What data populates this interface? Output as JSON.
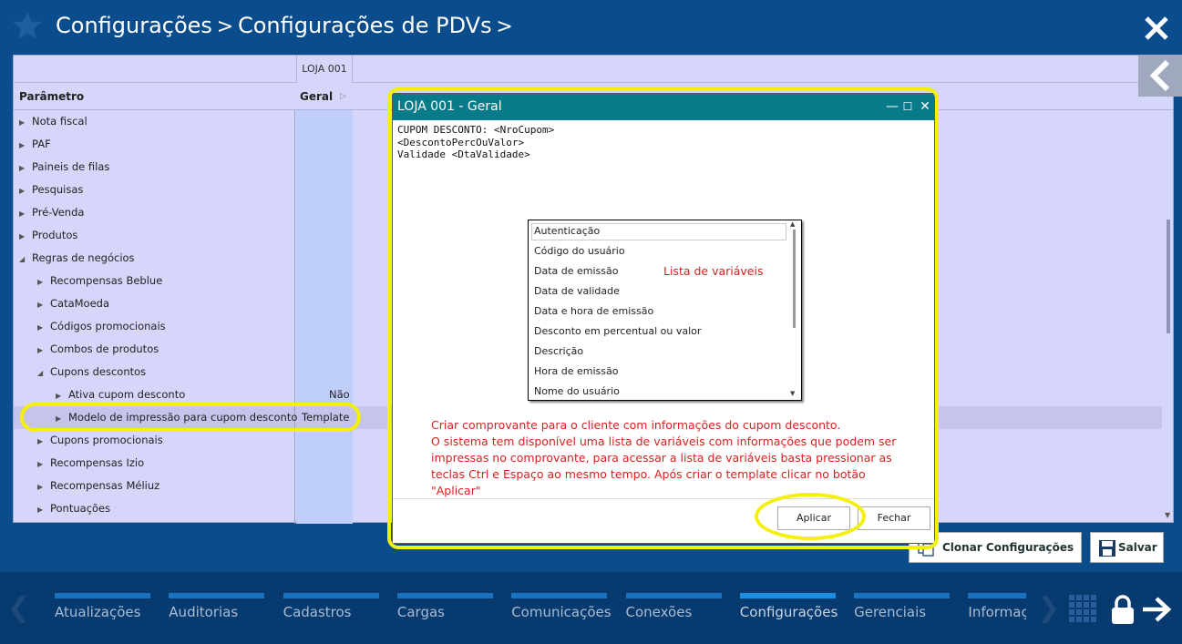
{
  "header": {
    "crumb_1": "Configurações",
    "crumb_2": "Configurações de PDVs",
    "separator": ">",
    "icons": [
      "star-icon",
      "close-icon"
    ]
  },
  "grid": {
    "loja_column": "LOJA 001",
    "param_header": "Parâmetro",
    "geral_header": "Geral",
    "tree": [
      {
        "label": "Nota fiscal",
        "level": 0,
        "expanded": false
      },
      {
        "label": "PAF",
        "level": 0,
        "expanded": false
      },
      {
        "label": "Paineis de filas",
        "level": 0,
        "expanded": false
      },
      {
        "label": "Pesquisas",
        "level": 0,
        "expanded": false
      },
      {
        "label": "Pré-Venda",
        "level": 0,
        "expanded": false
      },
      {
        "label": "Produtos",
        "level": 0,
        "expanded": false
      },
      {
        "label": "Regras de negócios",
        "level": 0,
        "expanded": true
      },
      {
        "label": "Recompensas Beblue",
        "level": 1,
        "expanded": false
      },
      {
        "label": "CataMoeda",
        "level": 1,
        "expanded": false
      },
      {
        "label": "Códigos promocionais",
        "level": 1,
        "expanded": false
      },
      {
        "label": "Combos de produtos",
        "level": 1,
        "expanded": false
      },
      {
        "label": "Cupons descontos",
        "level": 1,
        "expanded": true
      },
      {
        "label": "Ativa cupom desconto",
        "level": 2,
        "expanded": false
      },
      {
        "label": "Modelo de impressão para cupom desconto",
        "level": 2,
        "expanded": false
      },
      {
        "label": "Cupons promocionais",
        "level": 1,
        "expanded": false
      },
      {
        "label": "Recompensas Izio",
        "level": 1,
        "expanded": false
      },
      {
        "label": "Recompensas Méliuz",
        "level": 1,
        "expanded": false
      },
      {
        "label": "Pontuações",
        "level": 1,
        "expanded": false
      }
    ],
    "values": {
      "ativa_cupom": "Não",
      "modelo_impressao": "Template"
    }
  },
  "buttons": {
    "clone": "Clonar Configurações",
    "save": "Salvar"
  },
  "dialog": {
    "title": "LOJA 001 - Geral",
    "editor_lines": [
      "CUPOM DESCONTO: <NroCupom>",
      "<DescontoPercOuValor>",
      "Validade <DtaValidade>"
    ],
    "variables": [
      "Autenticação",
      "Código do usuário",
      "Data de emissão",
      "Data de validade",
      "Data e hora de emissão",
      "Desconto em percentual ou valor",
      "Descrição",
      "Hora de emissão",
      "Nome do usuário"
    ],
    "variables_label": "Lista de variáveis",
    "instructions": [
      "Criar comprovante para o cliente com informações do cupom desconto.",
      "O sistema tem disponível uma lista de variáveis com informações que podem ser",
      "impressas no comprovante, para acessar a lista de variáveis basta pressionar as",
      "teclas Ctrl e Espaço ao mesmo tempo. Após criar o template clicar no botão \"Aplicar\""
    ],
    "apply": "Aplicar",
    "close": "Fechar",
    "controls": {
      "minimize": "—",
      "maximize": "☐",
      "close": "✕"
    }
  },
  "nav": {
    "tabs": [
      "Atualizações",
      "Auditorias",
      "Cadastros",
      "Cargas",
      "Comunicações",
      "Conexões",
      "Configurações",
      "Gerenciais",
      "Informaç"
    ],
    "active": "Configurações"
  },
  "colors": {
    "header_bg": "#0a4c8c",
    "panel_bg": "#d6d6fb",
    "dialog_title": "#087b8a",
    "highlight": "#f4f00a",
    "annotation": "#d92020"
  }
}
